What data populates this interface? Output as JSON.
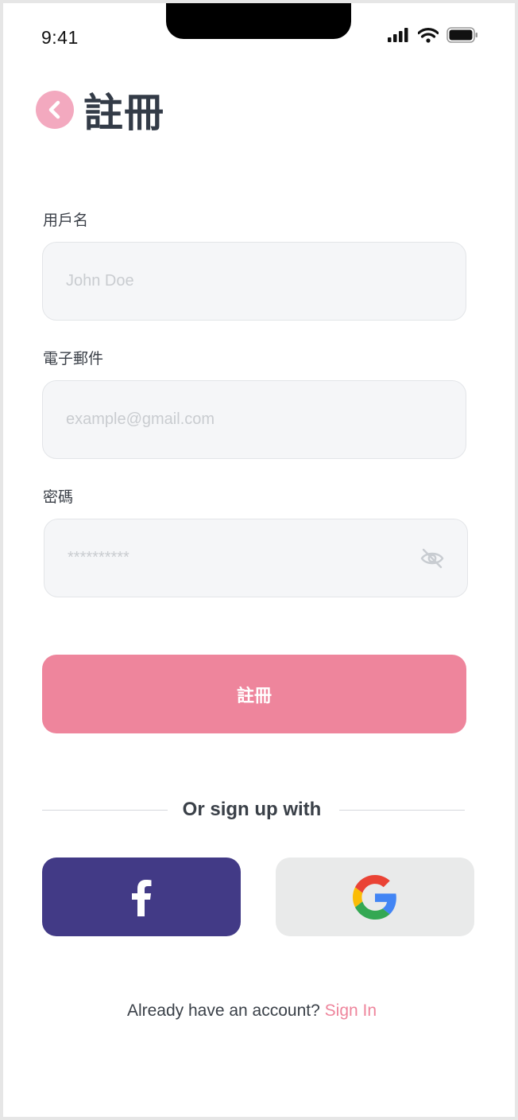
{
  "status_bar": {
    "time": "9:41"
  },
  "header": {
    "title": "註冊"
  },
  "form": {
    "username": {
      "label": "用戶名",
      "placeholder": "John Doe",
      "value": ""
    },
    "email": {
      "label": "電子郵件",
      "placeholder": "example@gmail.com",
      "value": ""
    },
    "password": {
      "label": "密碼",
      "placeholder": "**********",
      "value": ""
    },
    "submit_label": "註冊"
  },
  "social": {
    "divider_text": "Or sign up with",
    "facebook_icon": "facebook-icon",
    "google_icon": "google-icon",
    "facebook_color": "#423a86",
    "google_bg": "#e9eaea"
  },
  "footer": {
    "prompt": "Already have an account?",
    "link": "Sign In"
  },
  "colors": {
    "accent": "#ee859c",
    "title": "#333b47"
  }
}
